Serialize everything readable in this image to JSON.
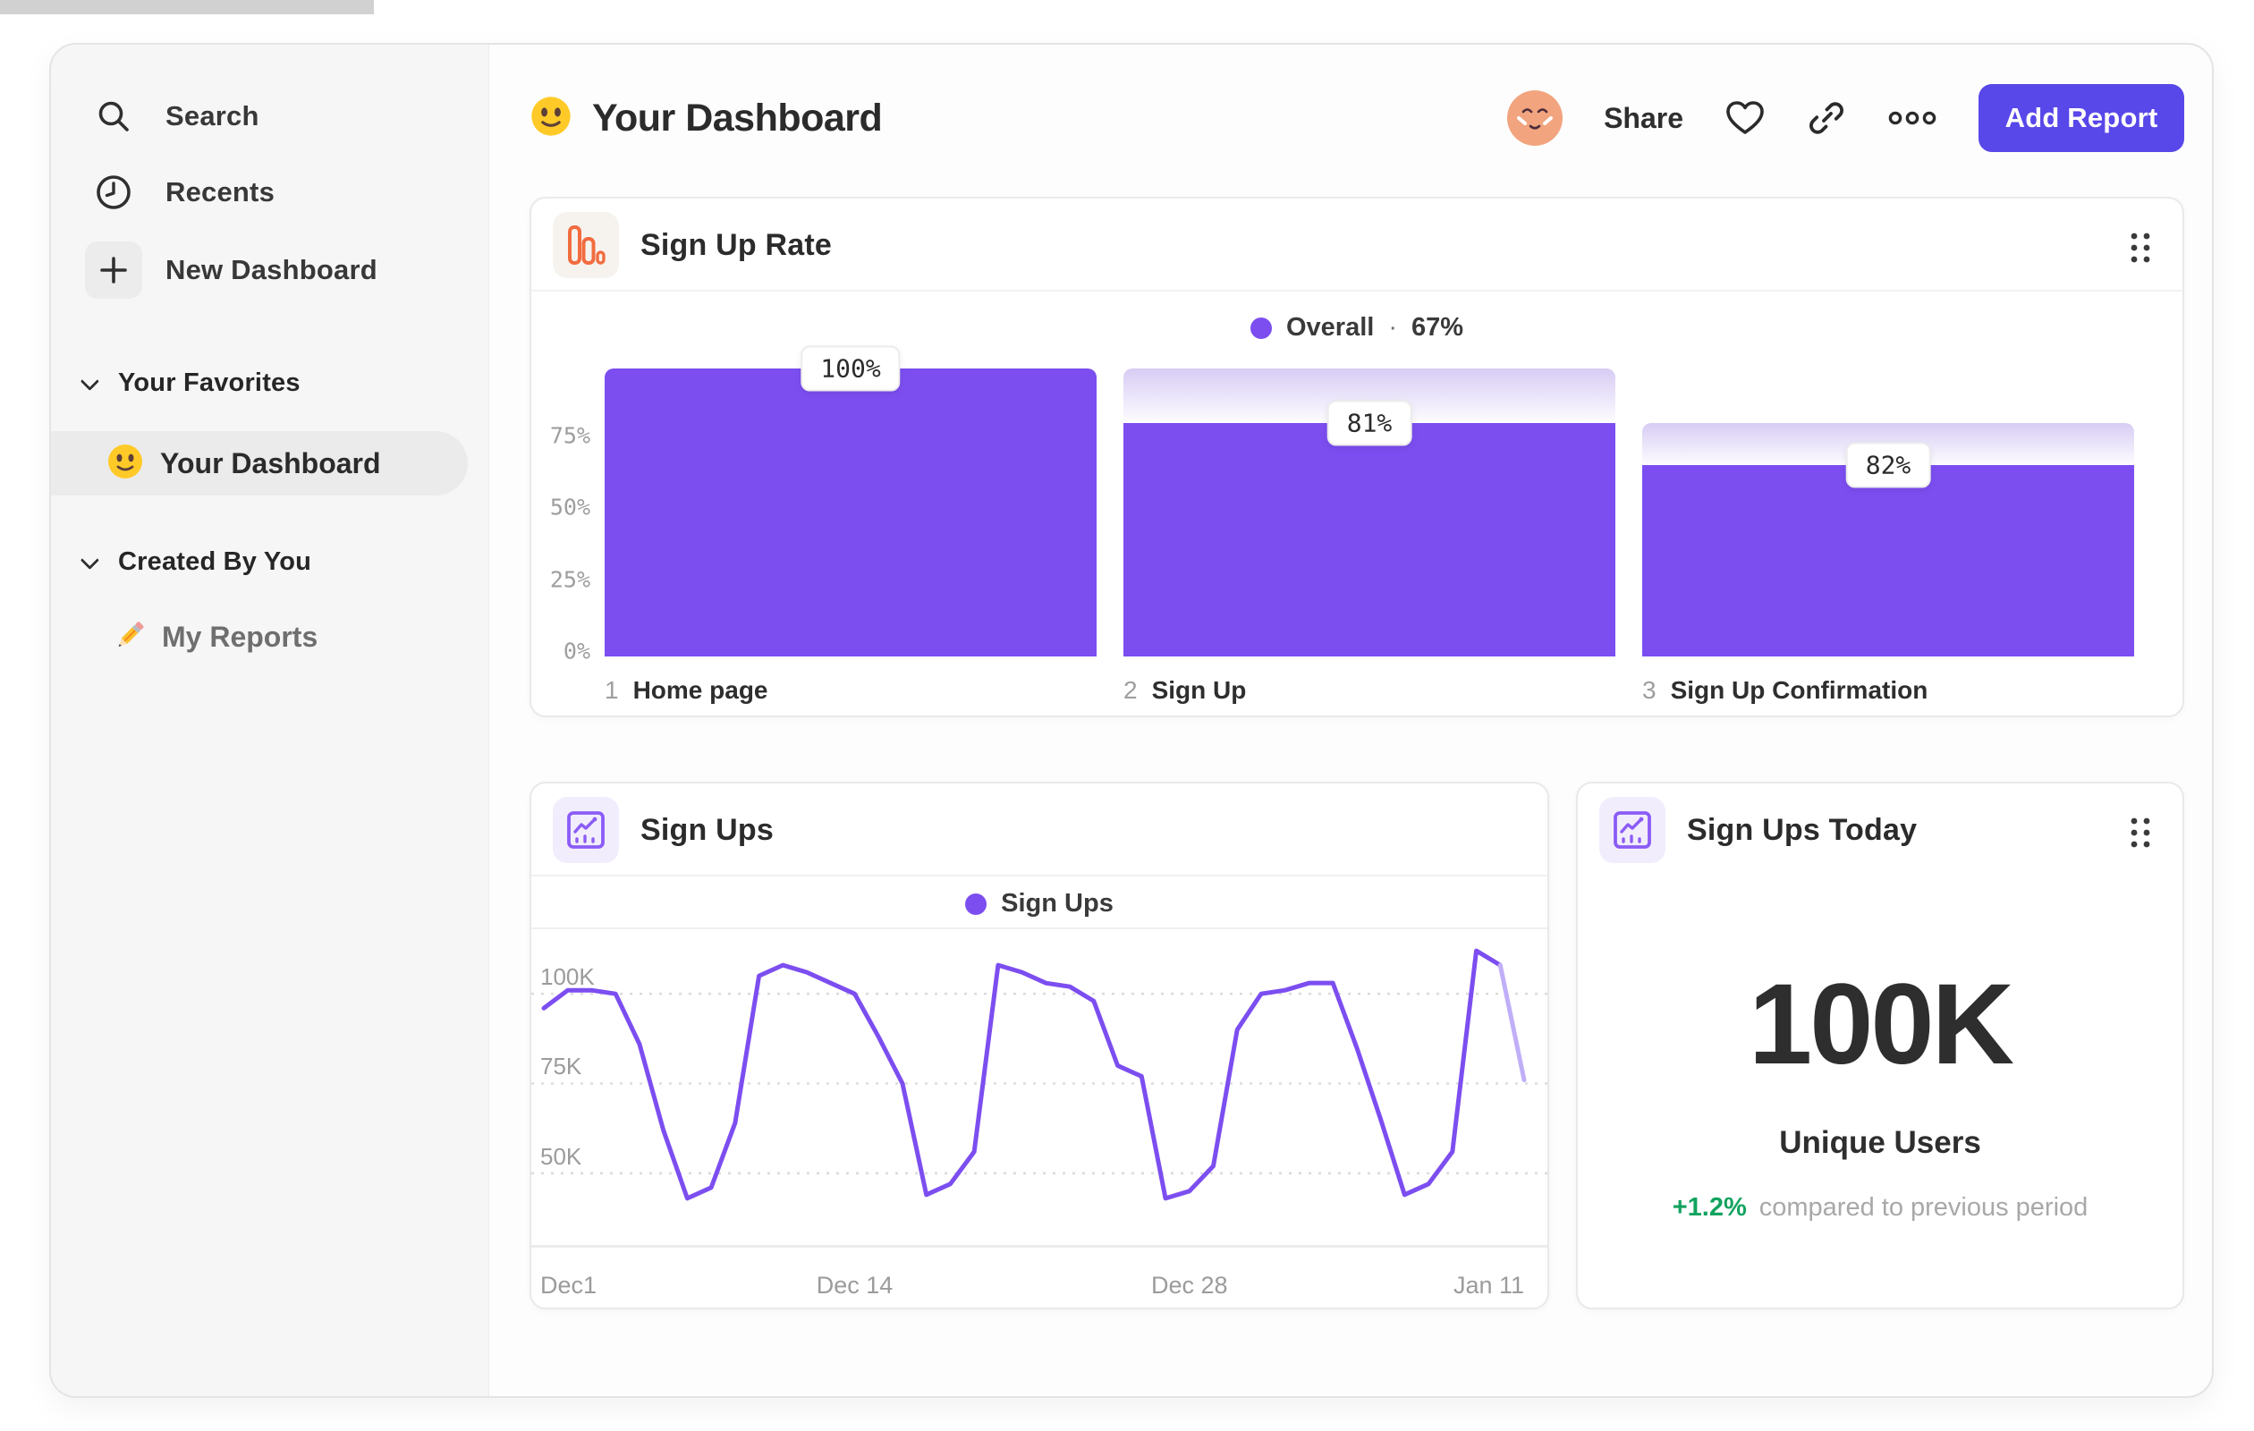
{
  "colors": {
    "accent_purple": "#7c4ef0",
    "light_funnel_gradient_top": "#d7ccf4",
    "button_indigo": "#5847e9",
    "funnel_icon_orange": "#f26c3f",
    "positive_green": "#12a35f",
    "sidebar_bg": "#f6f6f6",
    "avatar_skin": "#f2a47e"
  },
  "sidebar": {
    "items": [
      {
        "icon": "search-icon",
        "label": "Search"
      },
      {
        "icon": "clock-icon",
        "label": "Recents"
      },
      {
        "icon": "plus-icon",
        "label": "New Dashboard"
      }
    ],
    "sections": [
      {
        "label": "Your Favorites",
        "items": [
          {
            "icon": "smiley-emoji",
            "label": "Your Dashboard",
            "active": true
          }
        ]
      },
      {
        "label": "Created By You",
        "items": [
          {
            "icon": "pencil-emoji",
            "label": "My Reports",
            "active": false
          }
        ]
      }
    ]
  },
  "header": {
    "emoji": "smiley-emoji",
    "title": "Your Dashboard",
    "share_label": "Share",
    "icons": [
      "avatar",
      "heart-icon",
      "link-icon",
      "more-dots-icon"
    ],
    "add_report_label": "Add Report"
  },
  "cards": {
    "signup_rate": {
      "icon": "funnel-chart-icon",
      "title": "Sign Up Rate",
      "legend_name": "Overall",
      "legend_separator": "·",
      "legend_value": "67%"
    },
    "signups": {
      "icon": "line-chart-icon",
      "title": "Sign Ups",
      "legend_name": "Sign Ups"
    },
    "signups_today": {
      "icon": "line-chart-icon",
      "title": "Sign Ups Today",
      "value": "100K",
      "label": "Unique Users",
      "delta": "+1.2%",
      "delta_note": "compared to previous period"
    }
  },
  "chart_data": [
    {
      "type": "bar",
      "subtype": "funnel",
      "title": "Sign Up Rate",
      "legend": "Overall · 67%",
      "overall_conversion_pct": 67,
      "categories": [
        "Home page",
        "Sign Up",
        "Sign Up Confirmation"
      ],
      "step_numbers": [
        "1",
        "2",
        "3"
      ],
      "step_conversion_pct": [
        100,
        81,
        82
      ],
      "cumulative_pct": [
        100,
        81,
        66.5
      ],
      "value_labels": [
        "100%",
        "81%",
        "82%"
      ],
      "yticks": [
        "75%",
        "50%",
        "25%",
        "0%"
      ],
      "ytick_fractions": [
        0.25,
        0.5,
        0.75,
        1.0
      ],
      "ylim": [
        0,
        100
      ],
      "grid": false,
      "legend_position": "top-center"
    },
    {
      "type": "line",
      "title": "Sign Ups",
      "series": [
        {
          "name": "Sign Ups",
          "values_k": [
            96,
            101,
            101,
            100,
            86,
            62,
            43,
            46,
            64,
            105,
            108,
            106,
            103,
            100,
            88,
            75,
            44,
            47,
            56,
            108,
            106,
            103,
            102,
            98,
            80,
            77,
            43,
            45,
            52,
            90,
            100,
            101,
            103,
            103,
            85,
            65,
            44,
            47,
            56,
            112,
            108,
            76
          ]
        }
      ],
      "x_ticks": [
        "Dec1",
        "Dec 14",
        "Dec 28",
        "Jan 11"
      ],
      "x_tick_indices": [
        0,
        13,
        27,
        41
      ],
      "yticks": [
        "100K",
        "75K",
        "50K"
      ],
      "ytick_values_k": [
        100,
        75,
        50
      ],
      "ylim_k": [
        30,
        118
      ],
      "grid": "dashed-horizontal",
      "incomplete_tail": true,
      "legend_position": "top-center"
    },
    {
      "type": "stat",
      "title": "Sign Ups Today",
      "value": "100K",
      "label": "Unique Users",
      "delta": "+1.2%",
      "note": "compared to previous period"
    }
  ]
}
